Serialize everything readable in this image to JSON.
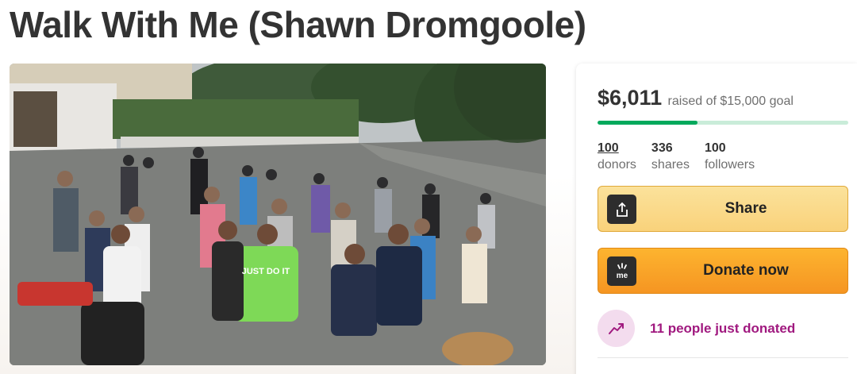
{
  "campaign": {
    "title": "Walk With Me (Shawn Dromgoole)"
  },
  "photo": {
    "sign_text": "JUST DO IT"
  },
  "donation": {
    "amount_raised": "$6,011",
    "goal_text": "raised of $15,000 goal",
    "progress_fraction": 0.4,
    "stats": [
      {
        "value": "100",
        "label": "donors"
      },
      {
        "value": "336",
        "label": "shares"
      },
      {
        "value": "100",
        "label": "followers"
      }
    ],
    "share_label": "Share",
    "donate_label": "Donate now",
    "donate_icon_text": "me",
    "recent_donations_text": "11 people just donated"
  },
  "colors": {
    "progress_fill": "#02a95c",
    "progress_track": "#c9ecd9",
    "share_button": "#f9d27b",
    "donate_button": "#f8a826",
    "recent_text": "#a0197f"
  }
}
